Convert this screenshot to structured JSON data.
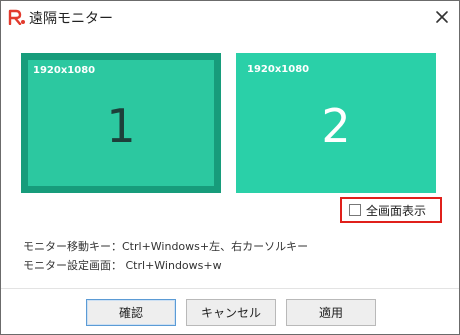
{
  "window": {
    "title": "遠隔モニター",
    "close_icon": "close-icon",
    "logo_icon": "app-logo-icon"
  },
  "monitors": [
    {
      "resolution": "1920x1080",
      "number": "1",
      "selected": true
    },
    {
      "resolution": "1920x1080",
      "number": "2",
      "selected": false
    }
  ],
  "fullscreen": {
    "label": "全画面表示",
    "checked": false
  },
  "hints": {
    "move_key": "モニター移動キー：Ctrl+Windows+左、右カーソルキー",
    "settings_key": "モニター設定画面：  Ctrl+Windows+w"
  },
  "buttons": {
    "ok": "確認",
    "cancel": "キャンセル",
    "apply": "適用"
  },
  "colors": {
    "monitor_selected_fill": "#2cc8a0",
    "monitor_selected_border": "#179c7b",
    "monitor_fill": "#2ad0a8",
    "highlight": "#e0201b"
  }
}
